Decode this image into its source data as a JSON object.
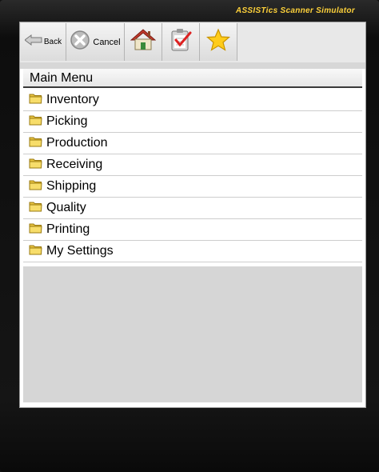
{
  "app": {
    "title": "ASSISTics Scanner Simulator"
  },
  "toolbar": {
    "back_label": "Back",
    "cancel_label": "Cancel",
    "buttons": [
      {
        "icon": "back-arrow-icon"
      },
      {
        "icon": "cancel-x-icon"
      },
      {
        "icon": "home-icon"
      },
      {
        "icon": "clipboard-check-icon"
      },
      {
        "icon": "star-icon"
      }
    ]
  },
  "menu": {
    "title": "Main Menu",
    "items": [
      {
        "label": "Inventory"
      },
      {
        "label": "Picking"
      },
      {
        "label": "Production"
      },
      {
        "label": "Receiving"
      },
      {
        "label": "Shipping"
      },
      {
        "label": "Quality"
      },
      {
        "label": "Printing"
      },
      {
        "label": "My Settings"
      }
    ]
  },
  "colors": {
    "title_accent": "#ffd23a",
    "folder": "#f3d25a",
    "background": "#d6d6d6"
  }
}
